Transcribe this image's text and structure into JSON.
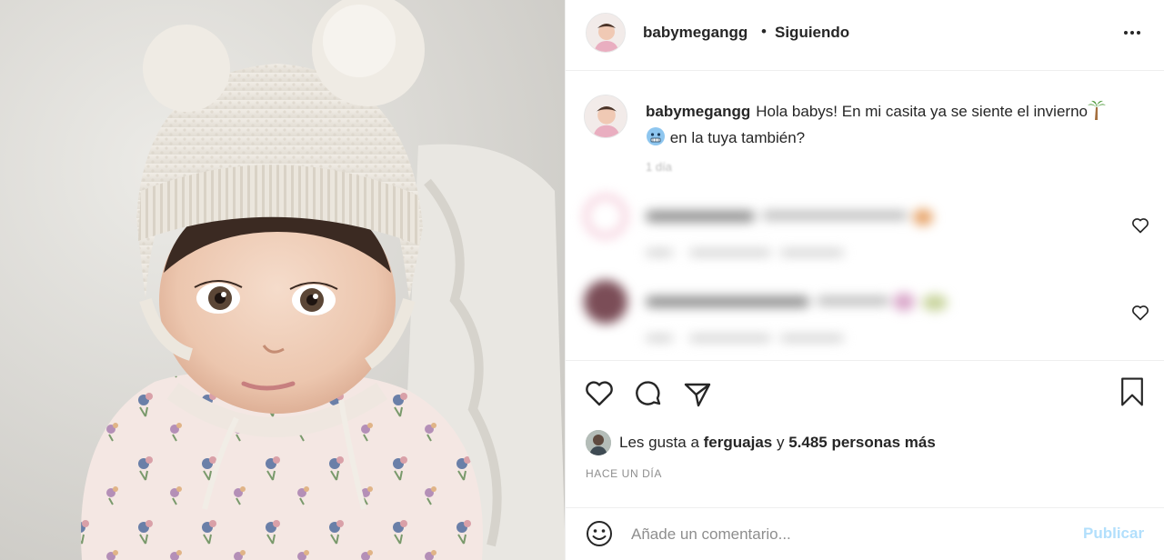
{
  "post": {
    "author": "babymegangg",
    "separator": "•",
    "follow_status": "Siguiendo",
    "caption_text": "Hola babys! En mi casita ya se siente el invierno",
    "caption_tail": " en la tuya también?",
    "caption_emojis": [
      "palm-tree-emoji",
      "cold-face-emoji"
    ],
    "caption_time": "1 día"
  },
  "comments": [
    {
      "blurred": true,
      "like_icon": "heart-outline-icon"
    },
    {
      "blurred": true,
      "like_icon": "heart-outline-icon"
    }
  ],
  "actions": {
    "icons": [
      "heart-outline-icon",
      "comment-bubble-icon",
      "share-paper-plane-icon",
      "bookmark-icon"
    ]
  },
  "likes": {
    "prefix": "Les gusta a ",
    "user": "ferguajas",
    "joiner": " y ",
    "others": "5.485 personas más"
  },
  "date": "HACE UN DÍA",
  "composer": {
    "placeholder": "Añade un comentario...",
    "publish_label": "Publicar",
    "emoji_icon": "smiley-face-icon"
  },
  "colors": {
    "text": "#262626",
    "muted": "#8e8e8e",
    "divider": "#efefef",
    "publish_disabled": "#b2dffc"
  }
}
